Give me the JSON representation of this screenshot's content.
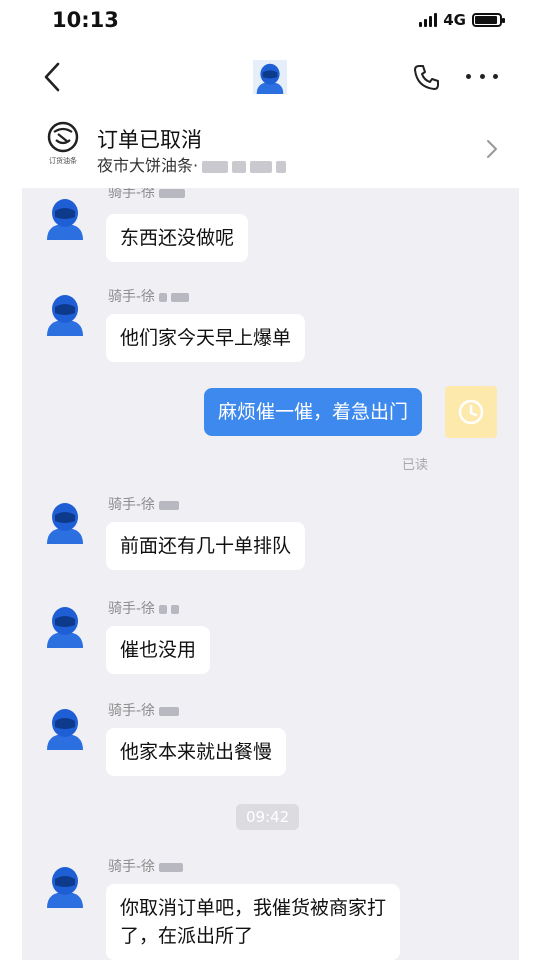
{
  "status_bar": {
    "time": "10:13",
    "network": "4G",
    "battery_level": 0.85
  },
  "nav": {
    "back_icon": "chevron-left-icon",
    "call_icon": "phone-icon",
    "more_icon": "more-dots-icon"
  },
  "order": {
    "title": "订单已取消",
    "shop_name": "夜市大饼油条·",
    "logo_text": "订货油条"
  },
  "messages": [
    {
      "sender": "骑手-徐",
      "text": "东西还没做呢"
    },
    {
      "sender": "骑手-徐",
      "text": "他们家今天早上爆单"
    },
    {
      "text": "麻烦催一催，着急出门",
      "read": "已读"
    },
    {
      "sender": "骑手-徐",
      "text": "前面还有几十单排队"
    },
    {
      "sender": "骑手-徐",
      "text": "催也没用"
    },
    {
      "sender": "骑手-徐",
      "text": "他家本来就出餐慢"
    },
    {
      "timestamp": "09:42"
    },
    {
      "sender": "骑手-徐",
      "text_line1": "你取消订单吧，我催货被商家打",
      "text_line2": "了，在派出所了"
    }
  ],
  "colors": {
    "chat_background": "#efeff4",
    "my_bubble": "#3d89ee",
    "rider_helmet": "#1f5fd6",
    "my_avatar": "#fde9ac"
  }
}
